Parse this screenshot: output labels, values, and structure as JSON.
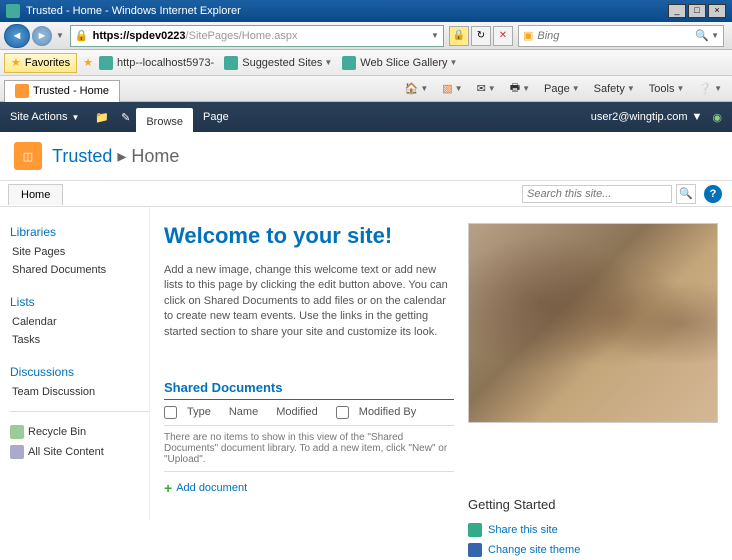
{
  "window": {
    "title": "Trusted - Home - Windows Internet Explorer"
  },
  "address": {
    "url_prefix": "https://spdev0223",
    "url_suffix": "/SitePages/Home.aspx",
    "search_placeholder": "Bing"
  },
  "favorites": {
    "label": "Favorites",
    "items": [
      {
        "label": "http--localhost5973-"
      },
      {
        "label": "Suggested Sites"
      },
      {
        "label": "Web Slice Gallery"
      }
    ]
  },
  "ie_tab": {
    "label": "Trusted - Home"
  },
  "ie_tools": [
    "Page",
    "Safety",
    "Tools"
  ],
  "ribbon": {
    "site_actions": "Site Actions",
    "tabs": [
      "Browse",
      "Page"
    ],
    "user": "user2@wingtip.com"
  },
  "breadcrumb": {
    "site": "Trusted",
    "page": "Home"
  },
  "top_nav": {
    "tab": "Home",
    "search_placeholder": "Search this site..."
  },
  "leftnav": {
    "groups": [
      {
        "header": "Libraries",
        "items": [
          "Site Pages",
          "Shared Documents"
        ]
      },
      {
        "header": "Lists",
        "items": [
          "Calendar",
          "Tasks"
        ]
      },
      {
        "header": "Discussions",
        "items": [
          "Team Discussion"
        ]
      }
    ],
    "footer": [
      {
        "label": "Recycle Bin",
        "icon": "recycle"
      },
      {
        "label": "All Site Content",
        "icon": "allcontent"
      }
    ]
  },
  "main": {
    "welcome": "Welcome to your site!",
    "intro": "Add a new image, change this welcome text or add new lists to this page by clicking the edit button above. You can click on Shared Documents to add files or on the calendar to create new team events. Use the links in the getting started section to share your site and customize its look.",
    "doclib": {
      "title": "Shared Documents",
      "columns": [
        "Type",
        "Name",
        "Modified",
        "Modified By"
      ],
      "empty": "There are no items to show in this view of the \"Shared Documents\" document library. To add a new item, click \"New\" or \"Upload\".",
      "add": "Add document"
    },
    "getting": {
      "title": "Getting Started",
      "items": [
        {
          "label": "Share this site",
          "color": "#3a8"
        },
        {
          "label": "Change site theme",
          "color": "#36a"
        }
      ]
    }
  }
}
